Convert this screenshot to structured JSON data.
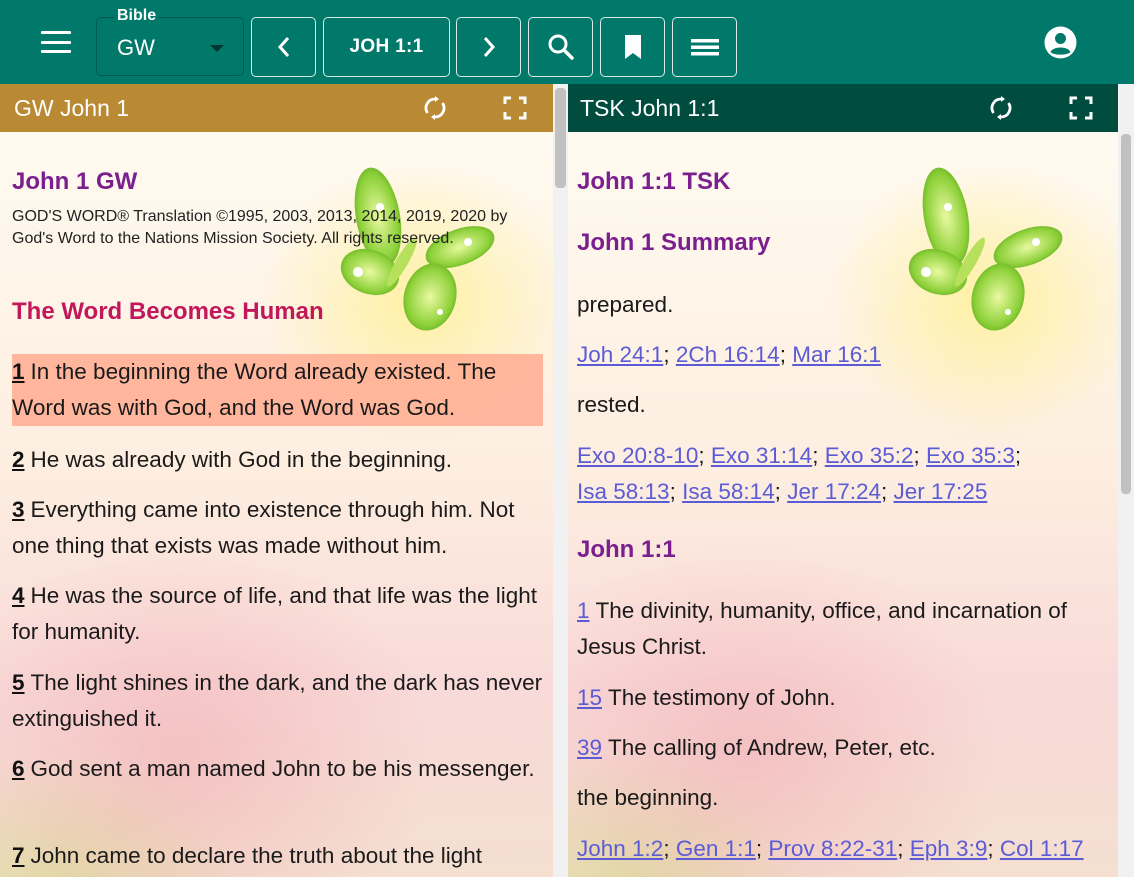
{
  "topbar": {
    "bible_label": "Bible",
    "bible_value": "GW",
    "reference": "JOH 1:1",
    "color": "#00796b"
  },
  "left_pane": {
    "header": "GW John 1",
    "header_color": "#b98a33",
    "book_title": "John 1 GW",
    "copyright": "GOD'S WORD® Translation ©1995, 2003, 2013, 2014, 2019, 2020 by God's Word to the Nations Mission Society. All rights reserved.",
    "section_title": "The Word Becomes Human",
    "verses": [
      {
        "num": "1",
        "text": "In the beginning the Word already existed. The Word was with God, and the Word was God."
      },
      {
        "num": "2",
        "text": "He was already with God in the beginning."
      },
      {
        "num": "3",
        "text": "Everything came into existence through him. Not one thing that exists was made without him."
      },
      {
        "num": "4",
        "text": "He was the source of life, and that life was the light for humanity."
      },
      {
        "num": "5",
        "text": "The light shines in the dark, and the dark has never extinguished it."
      },
      {
        "num": "6",
        "text": "God sent a man named John to be his messenger."
      },
      {
        "num": "7",
        "text": "John came to declare the truth about the light"
      }
    ]
  },
  "right_pane": {
    "header": "TSK John 1:1",
    "header_color": "#004d40",
    "title": "John 1:1 TSK",
    "summary_title": "John 1 Summary",
    "word1": "prepared.",
    "links1": [
      "Joh 24:1",
      "2Ch 16:14",
      "Mar 16:1"
    ],
    "word2": "rested.",
    "links2_line1": [
      "Exo 20:8-10",
      "Exo 31:14",
      "Exo 35:2",
      "Exo 35:3"
    ],
    "links2_line2": [
      "Isa 58:13",
      "Isa 58:14",
      "Jer 17:24",
      "Jer 17:25"
    ],
    "section_title": "John 1:1",
    "entries": [
      {
        "num": "1",
        "text": "The divinity, humanity, office, and incarnation of Jesus Christ."
      },
      {
        "num": "15",
        "text": "The testimony of John."
      },
      {
        "num": "39",
        "text": "The calling of Andrew, Peter, etc."
      }
    ],
    "word3": "the beginning.",
    "links3": [
      "John 1:2",
      "Gen 1:1",
      "Prov 8:22-31",
      "Eph 3:9",
      "Col 1:17"
    ]
  },
  "icons": {
    "menu": "menu-icon",
    "prev": "chevron-left-icon",
    "next": "chevron-right-icon",
    "search": "search-icon",
    "bookmark": "bookmark-icon",
    "list": "list-icon",
    "account": "account-circle-icon",
    "sync": "sync-icon",
    "fullscreen": "fullscreen-icon"
  }
}
